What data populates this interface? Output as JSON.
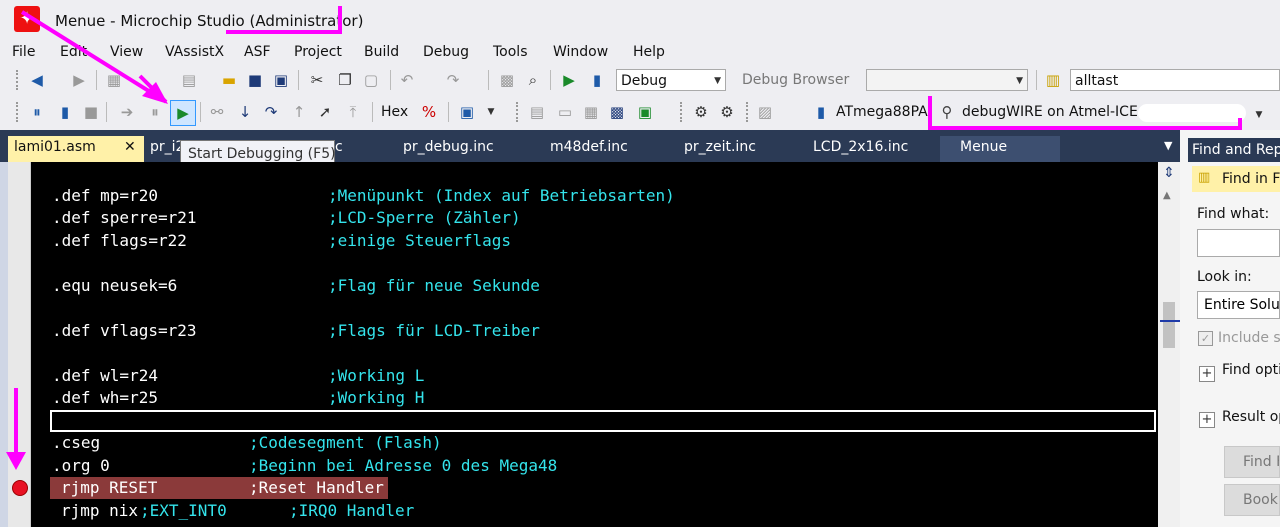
{
  "window": {
    "title": "Menue - Microchip Studio (Administrator)"
  },
  "menu": [
    "File",
    "Edit",
    "View",
    "VAssistX",
    "ASF",
    "Project",
    "Build",
    "Debug",
    "Tools",
    "Window",
    "Help"
  ],
  "toolbar1": {
    "config": "Debug",
    "debug_browser": "Debug Browser",
    "search": "alltast"
  },
  "toolbar2": {
    "hex": "Hex",
    "device": "ATmega88PA",
    "tool": "debugWIRE on Atmel-ICE"
  },
  "tabs": [
    "lami01.asm",
    "pr_i2",
    "c",
    "pr_debug.inc",
    "m48def.inc",
    "pr_zeit.inc",
    "LCD_2x16.inc",
    "Menue"
  ],
  "tooltip": "Start Debugging (F5)",
  "code": [
    {
      "text": ".def mp=r20",
      "comment": ";Menüpunkt (Index auf Betriebsarten)"
    },
    {
      "text": ".def sperre=r21",
      "comment": ";LCD-Sperre (Zähler)"
    },
    {
      "text": ".def flags=r22",
      "comment": ";einige Steuerflags"
    },
    {
      "text": ".equ neusek=6",
      "comment": ";Flag für neue Sekunde"
    },
    {
      "text": ".def vflags=r23",
      "comment": ";Flags für LCD-Treiber"
    },
    {
      "text": ".def wl=r24",
      "comment": ";Working L"
    },
    {
      "text": ".def wh=r25",
      "comment": ";Working H"
    },
    {
      "text": ".cseg",
      "comment": ";Codesegment (Flash)"
    },
    {
      "text": ".org 0",
      "comment": ";Beginn bei Adresse 0 des Mega48"
    },
    {
      "text": "rjmp RESET",
      "comment": ";Reset Handler"
    },
    {
      "text": "rjmp nix",
      "comment": ";EXT_INT0",
      "comment2": ";IRQ0 Handler"
    }
  ],
  "right_panel": {
    "header": "Find and Rep",
    "tab": "Find in Fi",
    "find_what": "Find what:",
    "look_in": "Look in:",
    "look_in_value": "Entire Soluti",
    "include": "Include su",
    "find_options": "Find opti",
    "result_options": "Result op",
    "btn1": "Find F",
    "btn2": "Bookm"
  },
  "colors": {
    "annotation": "#ff00ff",
    "comment": "#34e4ec",
    "tab_bg": "#2b3a55",
    "active_tab": "#fff1a8"
  }
}
